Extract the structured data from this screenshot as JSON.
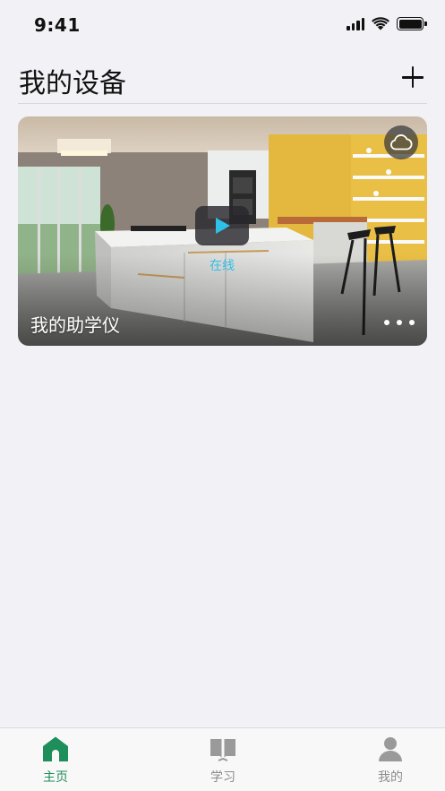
{
  "status_bar": {
    "time": "9:41",
    "icons": [
      "signal-icon",
      "wifi-icon",
      "battery-icon"
    ]
  },
  "header": {
    "title": "我的设备",
    "add_icon": "plus-icon"
  },
  "device": {
    "name": "我的助学仪",
    "status": "在线",
    "status_color": "#2fc0ea",
    "cloud_icon": "cloud-icon",
    "play_icon": "play-icon",
    "more_icon": "more-dots-icon"
  },
  "tab_bar": {
    "active_color": "#1e8e5a",
    "inactive_color": "#8c8c8c",
    "tabs": [
      {
        "label": "主页",
        "icon": "home-icon",
        "active": true
      },
      {
        "label": "学习",
        "icon": "book-icon",
        "active": false
      },
      {
        "label": "我的",
        "icon": "person-icon",
        "active": false
      }
    ]
  }
}
